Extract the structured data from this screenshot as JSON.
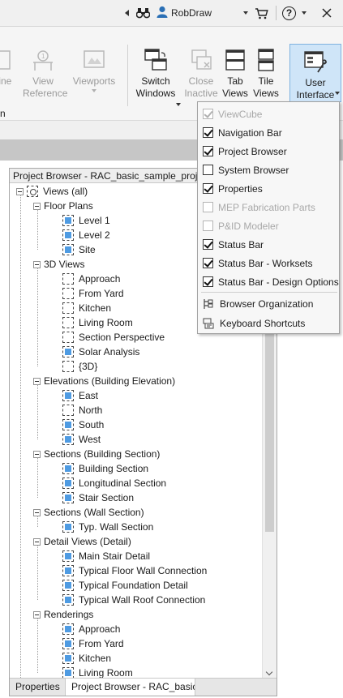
{
  "topbar": {
    "user": "RobDraw",
    "help_symbol": "?"
  },
  "ribbon": {
    "buttons": [
      {
        "id": "close-inactive",
        "label": "line",
        "enabled": false
      },
      {
        "id": "view-reference",
        "label": "View\nReference",
        "enabled": false
      },
      {
        "id": "viewports",
        "label": "Viewports",
        "enabled": false
      },
      {
        "id": "switch-windows",
        "label": "Switch\nWindows",
        "enabled": true
      },
      {
        "id": "close-inactive-btn",
        "label": "Close\nInactive",
        "enabled": false
      },
      {
        "id": "tab-views",
        "label": "Tab\nViews",
        "enabled": true
      },
      {
        "id": "tile-views",
        "label": "Tile\nViews",
        "enabled": true
      },
      {
        "id": "user-interface",
        "label": "User\nInterface",
        "enabled": true
      }
    ],
    "panel_letter": "n"
  },
  "menu": {
    "items": [
      {
        "label": "ViewCube",
        "checked": true,
        "enabled": false
      },
      {
        "label": "Navigation Bar",
        "checked": true,
        "enabled": true
      },
      {
        "label": "Project Browser",
        "checked": true,
        "enabled": true
      },
      {
        "label": "System Browser",
        "checked": false,
        "enabled": true
      },
      {
        "label": "Properties",
        "checked": true,
        "enabled": true
      },
      {
        "label": "MEP Fabrication Parts",
        "checked": false,
        "enabled": false
      },
      {
        "label": "P&ID Modeler",
        "checked": false,
        "enabled": false
      },
      {
        "label": "Status Bar",
        "checked": true,
        "enabled": true
      },
      {
        "label": "Status Bar - Worksets",
        "checked": true,
        "enabled": true
      },
      {
        "label": "Status Bar - Design Options",
        "checked": true,
        "enabled": true
      }
    ],
    "actions": [
      {
        "label": "Browser Organization",
        "icon": "tree-icon"
      },
      {
        "label": "Keyboard Shortcuts",
        "icon": "keyboard-icon"
      }
    ]
  },
  "browser": {
    "title": "Project Browser - RAC_basic_sample_project",
    "root": "Views (all)",
    "groups": [
      {
        "label": "Floor Plans",
        "items": [
          {
            "label": "Level 1",
            "blue": true
          },
          {
            "label": "Level 2",
            "blue": true
          },
          {
            "label": "Site",
            "blue": true
          }
        ]
      },
      {
        "label": "3D Views",
        "items": [
          {
            "label": "Approach",
            "blue": false
          },
          {
            "label": "From Yard",
            "blue": false
          },
          {
            "label": "Kitchen",
            "blue": false
          },
          {
            "label": "Living Room",
            "blue": false
          },
          {
            "label": "Section Perspective",
            "blue": false
          },
          {
            "label": "Solar Analysis",
            "blue": true
          },
          {
            "label": "{3D}",
            "blue": false
          }
        ]
      },
      {
        "label": "Elevations (Building Elevation)",
        "items": [
          {
            "label": "East",
            "blue": true
          },
          {
            "label": "North",
            "blue": false
          },
          {
            "label": "South",
            "blue": true
          },
          {
            "label": "West",
            "blue": true
          }
        ]
      },
      {
        "label": "Sections (Building Section)",
        "items": [
          {
            "label": "Building Section",
            "blue": true
          },
          {
            "label": "Longitudinal Section",
            "blue": true
          },
          {
            "label": "Stair Section",
            "blue": true
          }
        ]
      },
      {
        "label": "Sections (Wall Section)",
        "items": [
          {
            "label": "Typ. Wall Section",
            "blue": true
          }
        ]
      },
      {
        "label": "Detail Views (Detail)",
        "items": [
          {
            "label": "Main Stair Detail",
            "blue": true
          },
          {
            "label": "Typical Floor Wall Connection",
            "blue": true
          },
          {
            "label": "Typical Foundation Detail",
            "blue": true
          },
          {
            "label": "Typical Wall Roof Connection",
            "blue": true
          }
        ]
      },
      {
        "label": "Renderings",
        "items": [
          {
            "label": "Approach",
            "blue": true
          },
          {
            "label": "From Yard",
            "blue": true
          },
          {
            "label": "Kitchen",
            "blue": true
          },
          {
            "label": "Living Room",
            "blue": true
          }
        ]
      }
    ],
    "tabs": [
      {
        "label": "Properties",
        "active": false
      },
      {
        "label": "Project Browser - RAC_basic_sample_project",
        "active": true
      }
    ]
  }
}
